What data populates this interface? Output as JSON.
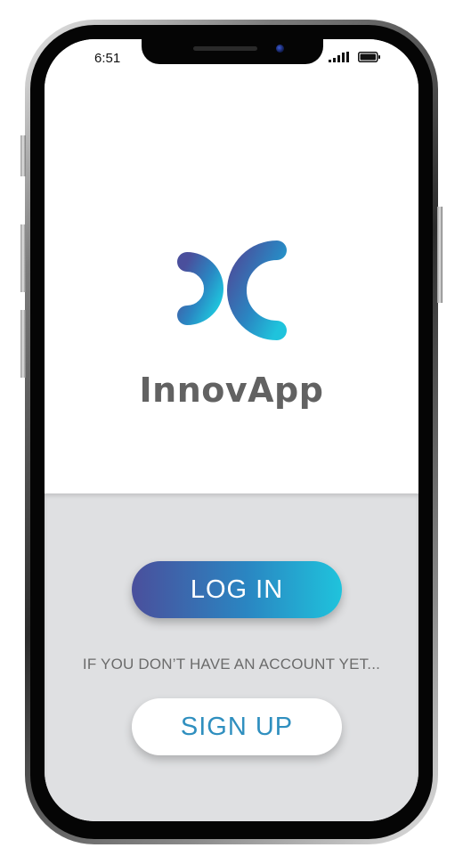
{
  "status_bar": {
    "time": "6:51",
    "icons": [
      "cellular-signal-icon",
      "battery-icon"
    ]
  },
  "app": {
    "name": "InnovApp",
    "logo_icon": "innovapp-logo-icon"
  },
  "actions": {
    "login_label": "LOG IN",
    "hint": "IF YOU DON’T HAVE AN ACCOUNT YET...",
    "signup_label": "SIGN UP"
  },
  "colors": {
    "brand_gradient_start": "#4a4f9c",
    "brand_gradient_end": "#1fc3dc",
    "signup_text": "#2f8fbf",
    "app_name_text": "#626262",
    "bottom_panel_bg": "#dfe0e2"
  }
}
